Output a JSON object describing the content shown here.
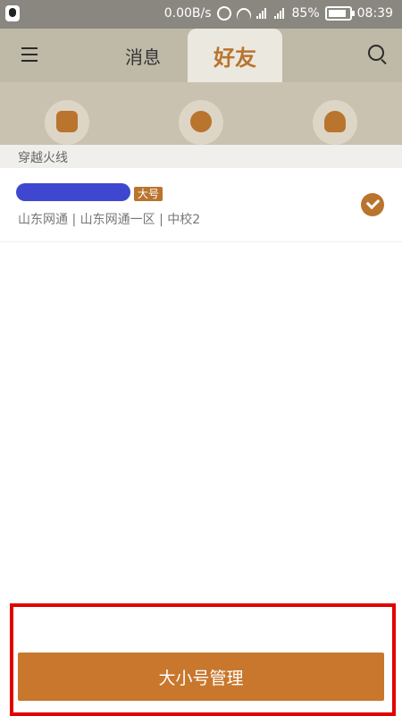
{
  "status_bar": {
    "net_speed": "0.00B/s",
    "battery": "85%",
    "time": "08:39"
  },
  "tabs": [
    {
      "label": "消息"
    },
    {
      "label": "好友"
    }
  ],
  "section": {
    "title": "穿越火线"
  },
  "account": {
    "badge": "大号",
    "details": "山东网通 | 山东网通一区 | 中校2"
  },
  "footer": {
    "manage_button": "大小号管理"
  },
  "colors": {
    "accent": "#c8772d",
    "highlight": "#e10000"
  },
  "icons": [
    "menu-icon",
    "search-icon",
    "badge-shield-icon",
    "crosshair-icon",
    "helmet-add-icon",
    "check-icon"
  ]
}
